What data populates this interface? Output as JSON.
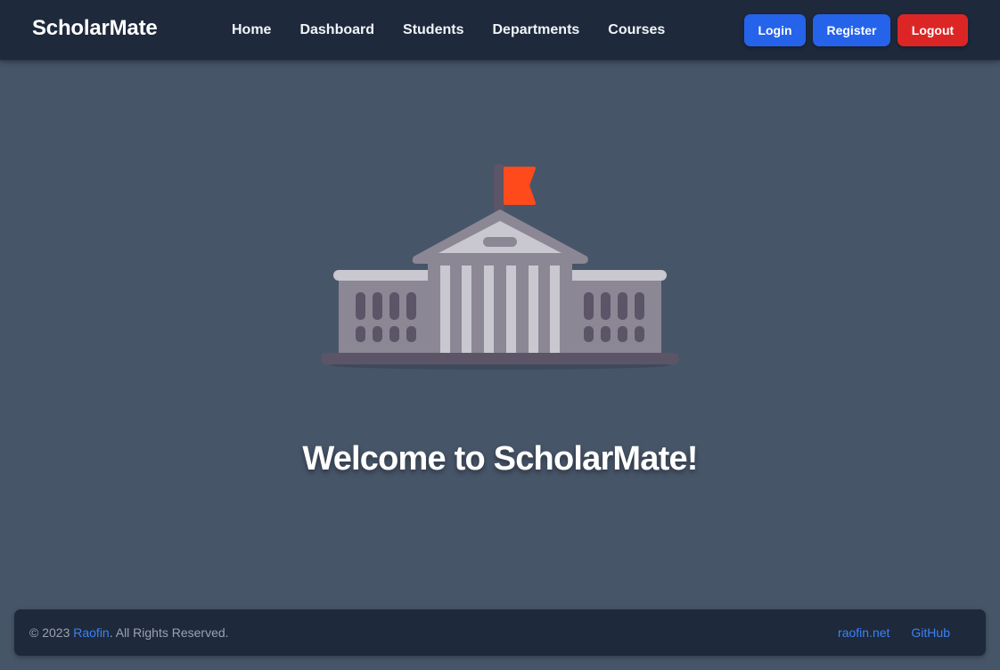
{
  "navbar": {
    "brand": "ScholarMate",
    "links": [
      "Home",
      "Dashboard",
      "Students",
      "Departments",
      "Courses"
    ],
    "buttons": {
      "login": "Login",
      "register": "Register",
      "logout": "Logout"
    }
  },
  "hero": {
    "illustration_icon": "university-building-icon",
    "heading": "Welcome to ScholarMate!"
  },
  "footer": {
    "copyright_prefix": "© 2023 ",
    "owner": "Raofin",
    "copyright_suffix": ". All Rights Reserved.",
    "links": [
      "raofin.net",
      "GitHub"
    ]
  },
  "colors": {
    "page_bg": "#475569",
    "navbar_bg": "#1e293b",
    "primary_button": "#2563eb",
    "danger_button": "#dc2626",
    "link": "#3b82f6",
    "flag": "#ff4a1c"
  }
}
